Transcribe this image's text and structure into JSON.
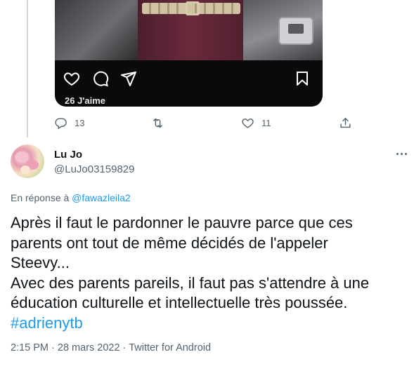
{
  "parent_tweet": {
    "embedded_instagram": {
      "likes_text": "26 J'aime"
    },
    "stats": {
      "replies": "13",
      "retweets": "",
      "likes": "11"
    }
  },
  "tweet": {
    "display_name": "Lu Jo",
    "handle": "@LuJo03159829",
    "reply_prefix": "En réponse à ",
    "reply_to": "@fawazleila2",
    "text_lines": [
      "Après il faut le pardonner le pauvre parce que ces",
      "parents ont tout de même décidés de l'appeler",
      "Steevy...",
      "Avec des parents pareils, il faut pas s'attendre à une",
      "éducation culturelle et intellectuelle très poussée."
    ],
    "hashtag": "#adrienytb",
    "time": "2:15 PM",
    "separator": " · ",
    "date": "28 mars 2022",
    "source": "Twitter for Android"
  },
  "colors": {
    "link": "#1d9bf0",
    "secondary_text": "#536471",
    "primary_text": "#0f1419"
  }
}
